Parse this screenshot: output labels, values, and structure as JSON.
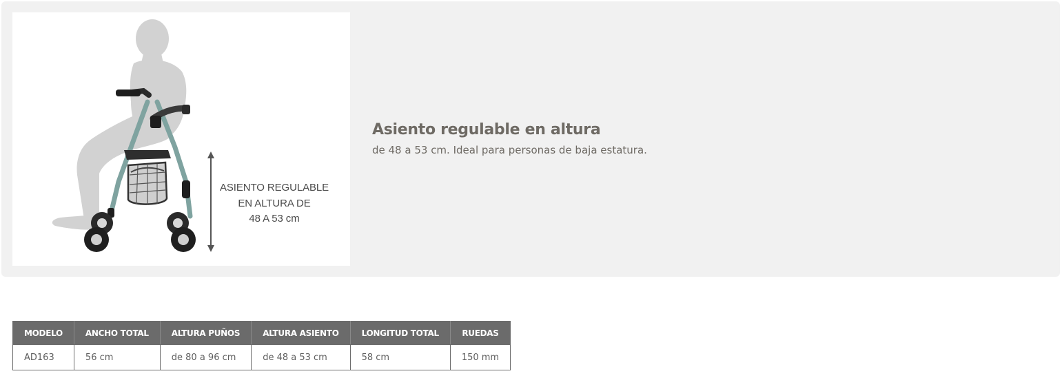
{
  "feature": {
    "image_caption": [
      "ASIENTO REGULABLE",
      "EN ALTURA DE",
      "48 A 53 cm"
    ],
    "title": "Asiento regulable en altura",
    "description": "de 48 a 53 cm. Ideal para personas de baja estatura."
  },
  "specs": {
    "headers": [
      "MODELO",
      "ANCHO TOTAL",
      "ALTURA PUÑOS",
      "ALTURA ASIENTO",
      "LONGITUD TOTAL",
      "RUEDAS"
    ],
    "rows": [
      [
        "AD163",
        "56 cm",
        "de 80 a 96 cm",
        "de 48 a 53 cm",
        "58 cm",
        "150 mm"
      ]
    ]
  },
  "colors": {
    "card_background": "#f1f1f1",
    "header_background": "#6b6b6b",
    "frame_color": "#7fa3a0",
    "text_color": "#6e6a64"
  }
}
